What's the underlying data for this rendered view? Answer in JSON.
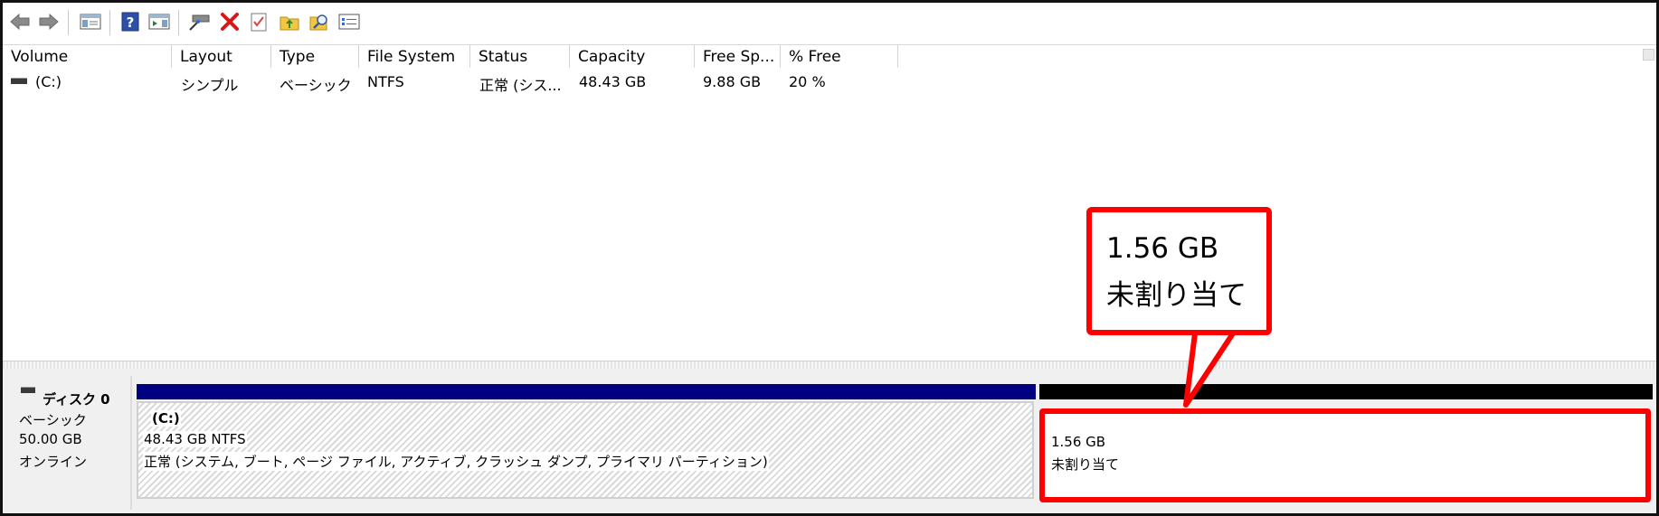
{
  "toolbar": {
    "buttons": [
      {
        "icon": "back-arrow-icon"
      },
      {
        "icon": "forward-arrow-icon"
      },
      {
        "icon": "console-tree-icon"
      },
      {
        "icon": "help-icon"
      },
      {
        "icon": "action-pane-icon"
      },
      {
        "icon": "connect-disk-icon"
      },
      {
        "icon": "delete-icon"
      },
      {
        "icon": "checklist-icon"
      },
      {
        "icon": "folder-up-icon"
      },
      {
        "icon": "folder-search-icon"
      },
      {
        "icon": "properties-icon"
      }
    ]
  },
  "volume_list": {
    "columns": [
      "Volume",
      "Layout",
      "Type",
      "File System",
      "Status",
      "Capacity",
      "Free Sp...",
      "% Free"
    ],
    "rows": [
      {
        "volume": "(C:)",
        "layout": "シンプル",
        "type": "ベーシック",
        "file_system": "NTFS",
        "status": "正常 (シス...",
        "capacity": "48.43 GB",
        "free_space": "9.88 GB",
        "percent_free": "20 %"
      }
    ]
  },
  "disk": {
    "name": "ディスク 0",
    "type": "ベーシック",
    "size": "50.00 GB",
    "state": "オンライン",
    "partitions": [
      {
        "label": "(C:)",
        "size_fs": "48.43 GB NTFS",
        "status": "正常 (システム, ブート, ページ ファイル, アクティブ, クラッシュ ダンプ, プライマリ パーティション)",
        "bar_color": "#000080"
      },
      {
        "size": "1.56 GB",
        "status": "未割り当て",
        "bar_color": "#000000"
      }
    ]
  },
  "callout": {
    "size": "1.56 GB",
    "status": "未割り当て",
    "color": "#ff0000"
  }
}
